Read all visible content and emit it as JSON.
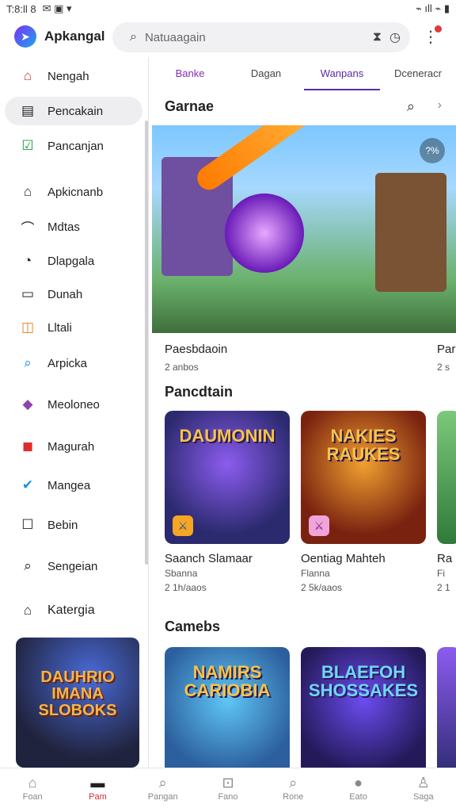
{
  "status": {
    "time": "T:8:ll 8",
    "icons_left": "✉ ▣ ▾",
    "icons_right": "⌁ ıll ⌁ ▮"
  },
  "header": {
    "app_name": "Apkangal",
    "search_placeholder": "Natuaagain",
    "notification_badge": "1"
  },
  "sidebar": {
    "items": [
      {
        "label": "Nengah",
        "icon": "home-icon"
      },
      {
        "label": "Pencakain",
        "icon": "bag-icon"
      },
      {
        "label": "Pancanjan",
        "icon": "check-icon"
      },
      {
        "label": "Apkicnanb",
        "icon": "house-icon"
      },
      {
        "label": "Mdtas",
        "icon": "leaf-icon"
      },
      {
        "label": "Dlapgala",
        "icon": "compass-icon"
      },
      {
        "label": "Dunah",
        "icon": "box-icon"
      },
      {
        "label": "Lltali",
        "icon": "arrow-icon"
      },
      {
        "label": "Arpicka",
        "icon": "search-icon"
      },
      {
        "label": "Meoloneo",
        "icon": "purple-icon"
      },
      {
        "label": "Magurah",
        "icon": "red-icon"
      },
      {
        "label": "Mangea",
        "icon": "check-blue-icon"
      },
      {
        "label": "Bebin",
        "icon": "square-icon"
      },
      {
        "label": "Sengeian",
        "icon": "search-icon"
      }
    ],
    "category_label": "Katergia",
    "promo_title": "DAUHRIO IMANA SLOBOKS"
  },
  "tabs": [
    "Banke",
    "Dagan",
    "Wanpans",
    "Dceneracr"
  ],
  "section1": {
    "title": "Garnae",
    "hero_badge": "?%"
  },
  "hero_items": [
    {
      "title": "Paesbdaoin",
      "sub": "2 anbos"
    },
    {
      "title": "Par",
      "sub": "2 s"
    }
  ],
  "section2": {
    "title": "Pancdtain"
  },
  "row2": [
    {
      "art": "DAUMONIN",
      "title": "Saanch Slamaar",
      "sub1": "Sbanna",
      "sub2": "2 1h/aaos"
    },
    {
      "art": "NAKIES RAUKES",
      "title": "Oentiag Mahteh",
      "sub1": "Flanna",
      "sub2": "2 5k/aaos"
    },
    {
      "art": "",
      "title": "Ra",
      "sub1": "Fi",
      "sub2": "2 1"
    }
  ],
  "section3": {
    "title": "Camebs"
  },
  "row3": [
    {
      "art": "NAMIRS CARIOBIA"
    },
    {
      "art": "BLAEFOH SHOSSAKES"
    },
    {
      "art": ""
    }
  ],
  "bottom_nav": [
    {
      "label": "Foan",
      "icon": "home-icon"
    },
    {
      "label": "Pam",
      "icon": "grid-icon"
    },
    {
      "label": "Pangan",
      "icon": "search-icon"
    },
    {
      "label": "Fano",
      "icon": "game-icon"
    },
    {
      "label": "Rone",
      "icon": "search-icon"
    },
    {
      "label": "Eato",
      "icon": "bubble-icon"
    },
    {
      "label": "Saga",
      "icon": "person-icon"
    }
  ]
}
